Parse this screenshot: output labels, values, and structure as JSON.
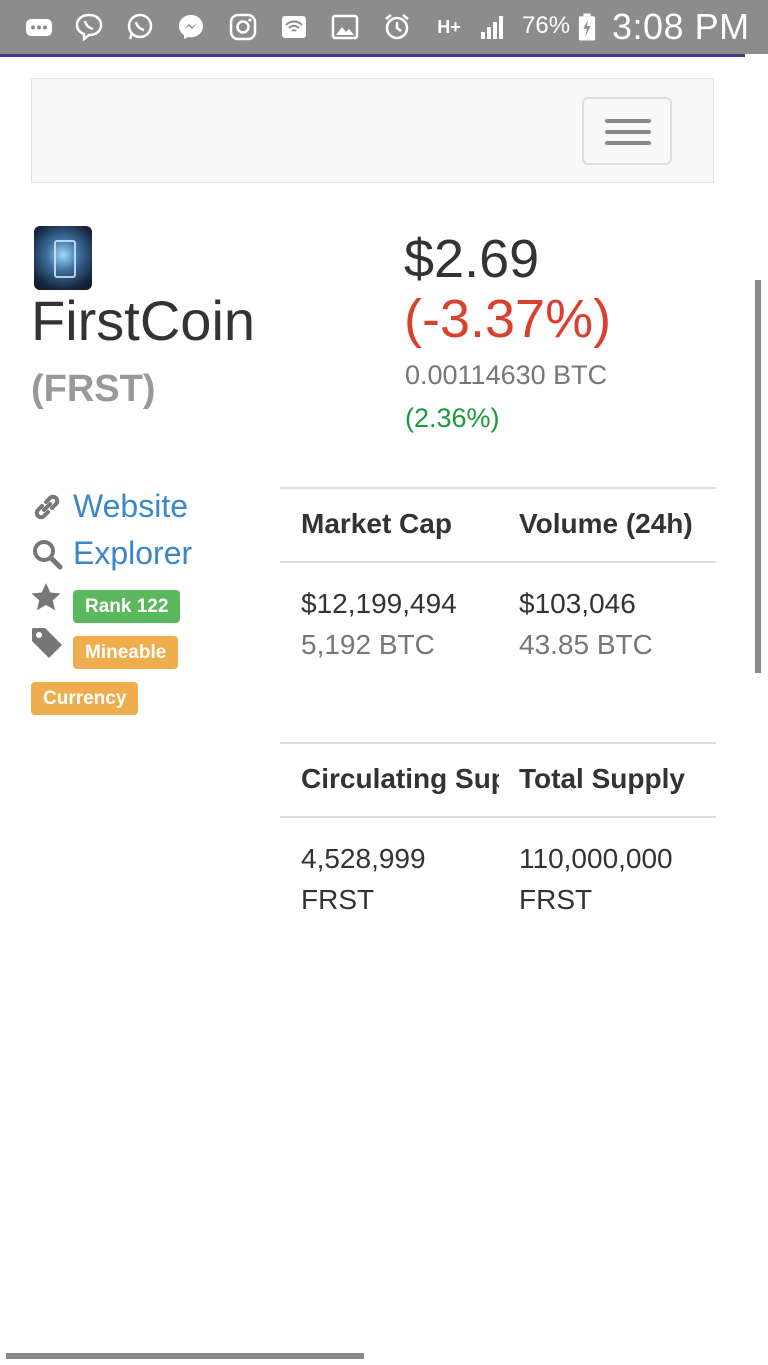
{
  "status_bar": {
    "icons": [
      "more-icon",
      "viber-icon",
      "whatsapp-icon",
      "messenger-icon",
      "instagram-icon",
      "wifi-icon",
      "gallery-icon",
      "alarm-icon",
      "network-type-icon",
      "signal-icon",
      "battery-icon"
    ],
    "network_type": "H+",
    "battery": "76%",
    "clock": "3:08 PM"
  },
  "coin": {
    "name": "FirstCoin",
    "symbol": "(FRST)",
    "price_usd": "$2.69",
    "change_usd": "(-3.37%)",
    "price_btc": "0.00114630 BTC",
    "change_btc": "(2.36%)"
  },
  "links": {
    "website": "Website",
    "explorer": "Explorer"
  },
  "labels": {
    "rank": "Rank 122",
    "mineable": "Mineable",
    "currency": "Currency"
  },
  "stats": {
    "market_cap_header": "Market Cap",
    "volume_header": "Volume (24h)",
    "market_cap_usd": "$12,199,494",
    "market_cap_btc": "5,192 BTC",
    "volume_usd": "$103,046",
    "volume_btc": "43.85 BTC",
    "circulating_header": "Circulating Supply",
    "total_supply_header": "Total Supply",
    "circulating_amount": "4,528,999",
    "circulating_unit": "FRST",
    "total_amount": "110,000,000",
    "total_unit": "FRST"
  },
  "colors": {
    "link": "#3c87c7",
    "negative": "#d9412e",
    "positive": "#1a9a3a",
    "label_green": "#5cb85c",
    "label_orange": "#f0ad4e",
    "status_bar": "#8c8c8c"
  }
}
